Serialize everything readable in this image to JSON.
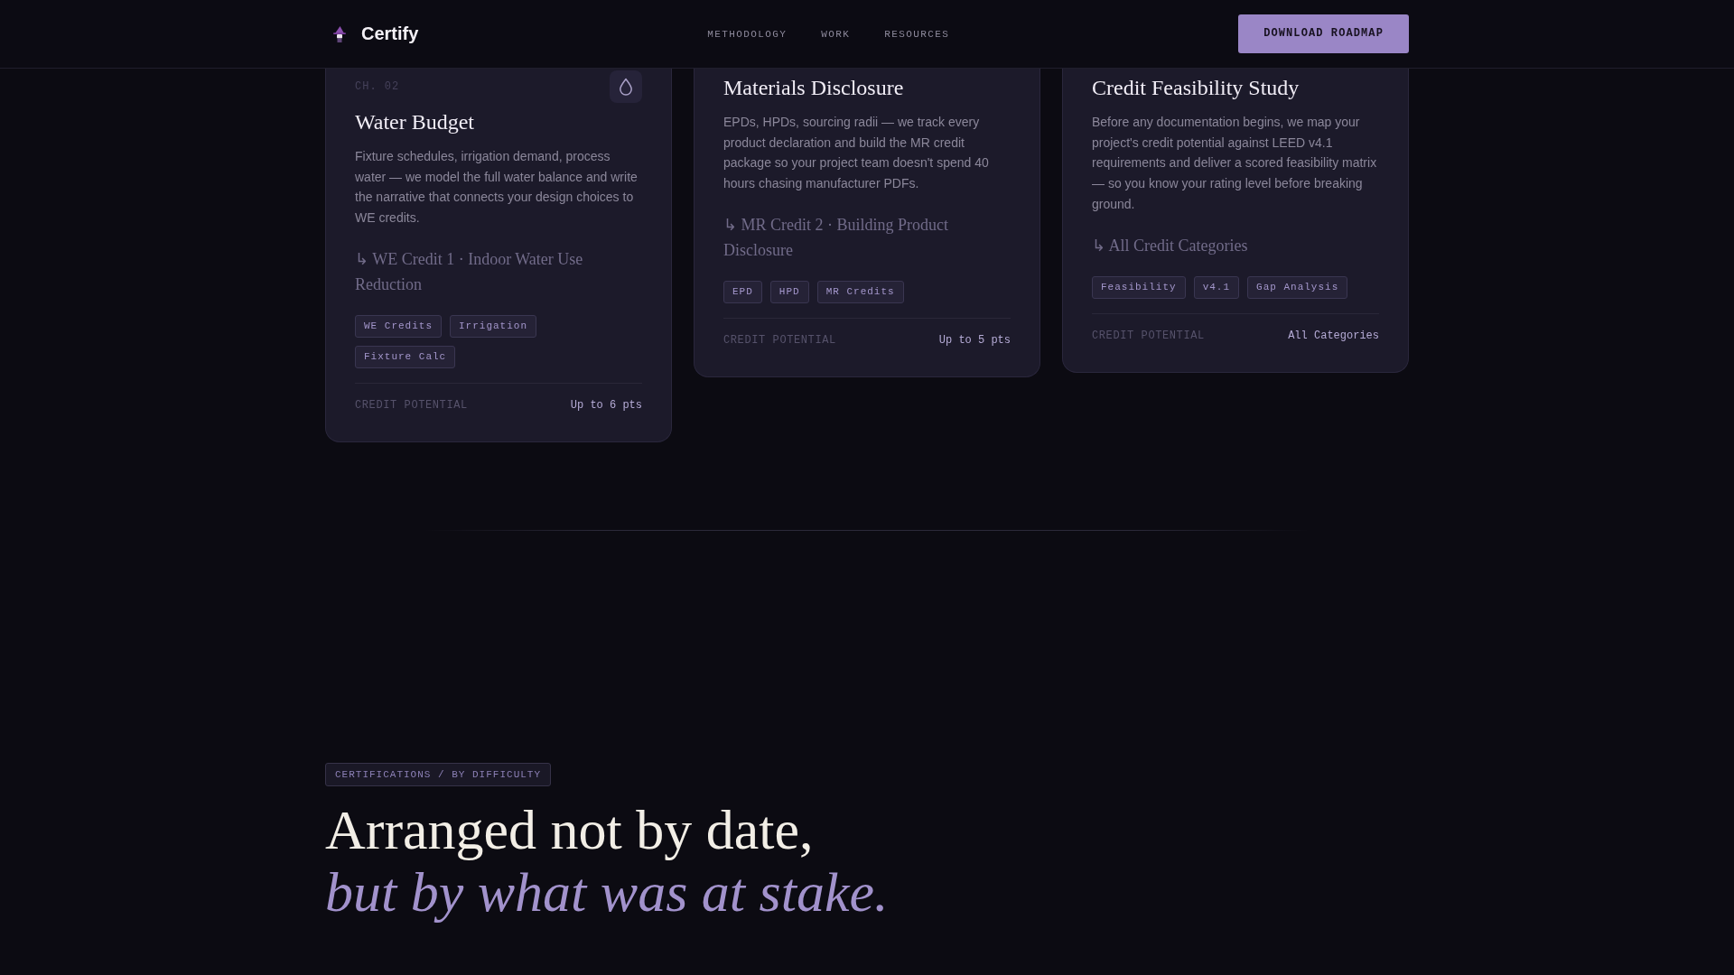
{
  "header": {
    "brand": "Certify",
    "nav": [
      {
        "label": "METHODOLOGY"
      },
      {
        "label": "WORK"
      },
      {
        "label": "RESOURCES"
      }
    ],
    "cta": "DOWNLOAD ROADMAP"
  },
  "cards": [
    {
      "chapter": "CH. 02",
      "title": "Water Budget",
      "description": "Fixture schedules, irrigation demand, process water — we model the full water balance and write the narrative that connects your design choices to WE credits.",
      "credit": "↳ WE Credit 1 · Indoor Water Use Reduction",
      "tags": [
        "WE Credits",
        "Irrigation",
        "Fixture Calc"
      ],
      "footer_label": "CREDIT POTENTIAL",
      "footer_value": "Up to 6 pts"
    },
    {
      "title": "Materials Disclosure",
      "description": "EPDs, HPDs, sourcing radii — we track every product declaration and build the MR credit package so your project team doesn't spend 40 hours chasing manufacturer PDFs.",
      "credit": "↳ MR Credit 2 · Building Product Disclosure",
      "tags": [
        "EPD",
        "HPD",
        "MR Credits"
      ],
      "footer_label": "CREDIT POTENTIAL",
      "footer_value": "Up to 5 pts"
    },
    {
      "title": "Credit Feasibility Study",
      "description": "Before any documentation begins, we map your project's credit potential against LEED v4.1 requirements and deliver a scored feasibility matrix — so you know your rating level before breaking ground.",
      "credit": "↳ All Credit Categories",
      "tags": [
        "Feasibility",
        "v4.1",
        "Gap Analysis"
      ],
      "footer_label": "CREDIT POTENTIAL",
      "footer_value": "All Categories"
    }
  ],
  "section": {
    "eyebrow": "CERTIFICATIONS / BY DIFFICULTY",
    "heading": "Arranged not by date, *but by what was at stake.*"
  }
}
